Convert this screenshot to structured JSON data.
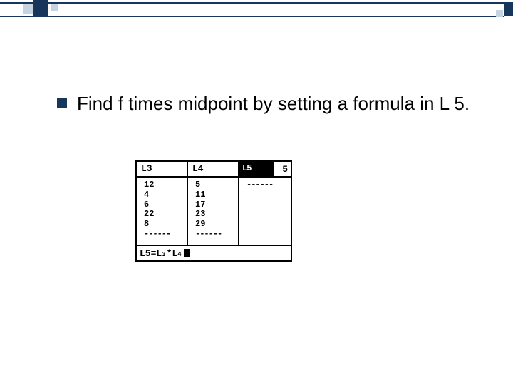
{
  "bullet": {
    "text": "Find f times midpoint by setting a formula in L 5."
  },
  "calc": {
    "headers": {
      "c1": "L3",
      "c2": "L4",
      "c3_label": "L5",
      "c3_right": "5"
    },
    "columns": {
      "l3": [
        "12",
        "4",
        "6",
        "22",
        "8",
        "------"
      ],
      "l4": [
        "5",
        "11",
        "17",
        "23",
        "29",
        "------"
      ],
      "l5": [
        "------"
      ]
    },
    "footer": {
      "lhs": "L5",
      "eq": " =",
      "t1": "L",
      "s1": "3",
      "star": "*",
      "t2": "L",
      "s2": "4"
    }
  }
}
